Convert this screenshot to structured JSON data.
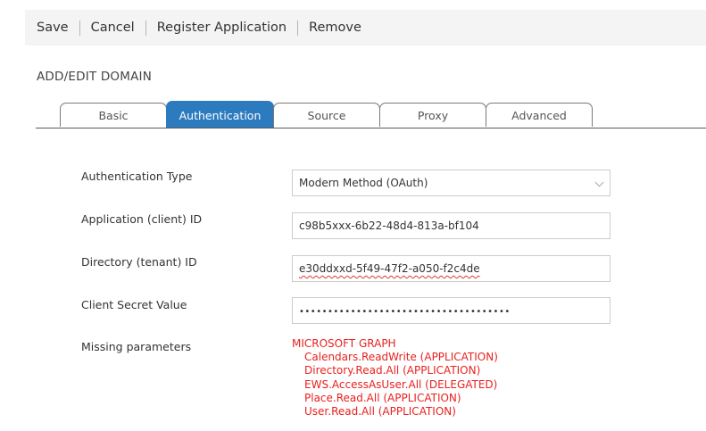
{
  "toolbar": {
    "save": "Save",
    "cancel": "Cancel",
    "register": "Register Application",
    "remove": "Remove"
  },
  "section_title": "ADD/EDIT DOMAIN",
  "tabs": [
    {
      "label": "Basic"
    },
    {
      "label": "Authentication",
      "active": true
    },
    {
      "label": "Source"
    },
    {
      "label": "Proxy"
    },
    {
      "label": "Advanced"
    }
  ],
  "form": {
    "auth_type": {
      "label": "Authentication Type",
      "value": "Modern Method (OAuth)"
    },
    "client_id": {
      "label": "Application (client) ID",
      "value": "c98b5xxx-6b22-48d4-813a-bf104"
    },
    "tenant_id": {
      "label": "Directory (tenant) ID",
      "value": "e30ddxxd-5f49-47f2-a050-f2c4de"
    },
    "client_secret": {
      "label": "Client Secret Value",
      "value": "•••••••••••••••••••••••••••••••••••••"
    },
    "missing": {
      "label": "Missing parameters",
      "group": "MICROSOFT GRAPH",
      "permissions": [
        "Calendars.ReadWrite (APPLICATION)",
        "Directory.Read.All (APPLICATION)",
        "EWS.AccessAsUser.All (DELEGATED)",
        "Place.Read.All (APPLICATION)",
        "User.Read.All (APPLICATION)"
      ]
    }
  },
  "colors": {
    "active_tab": "#2d7bbf",
    "error_text": "#e8221f",
    "toolbar_bg": "#f4f4f4"
  },
  "icons": {
    "select_arrow": "chevron-down-icon"
  }
}
